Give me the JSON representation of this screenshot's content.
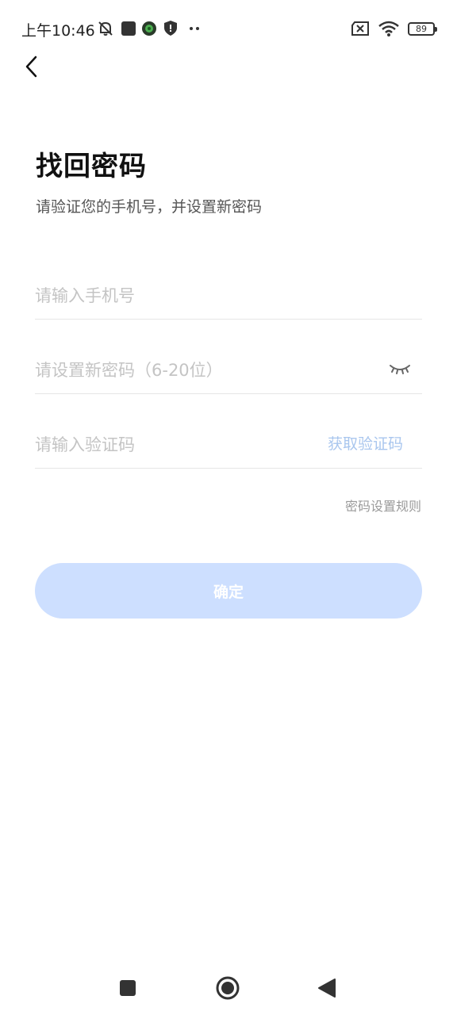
{
  "status_bar": {
    "time": "上午10:46",
    "battery": "89"
  },
  "header": {
    "title": "找回密码",
    "subtitle": "请验证您的手机号，并设置新密码"
  },
  "form": {
    "phone_placeholder": "请输入手机号",
    "password_placeholder": "请设置新密码（6-20位）",
    "code_placeholder": "请输入验证码",
    "get_code_label": "获取验证码",
    "rules_label": "密码设置规则",
    "confirm_label": "确定"
  },
  "colors": {
    "accent_disabled": "#cddfff",
    "link_disabled": "#a9c6ee"
  },
  "icons": {
    "back": "chevron-left-icon",
    "eye": "eye-closed-icon",
    "nav_recent": "square-icon",
    "nav_home": "circle-icon",
    "nav_back": "triangle-left-icon"
  }
}
